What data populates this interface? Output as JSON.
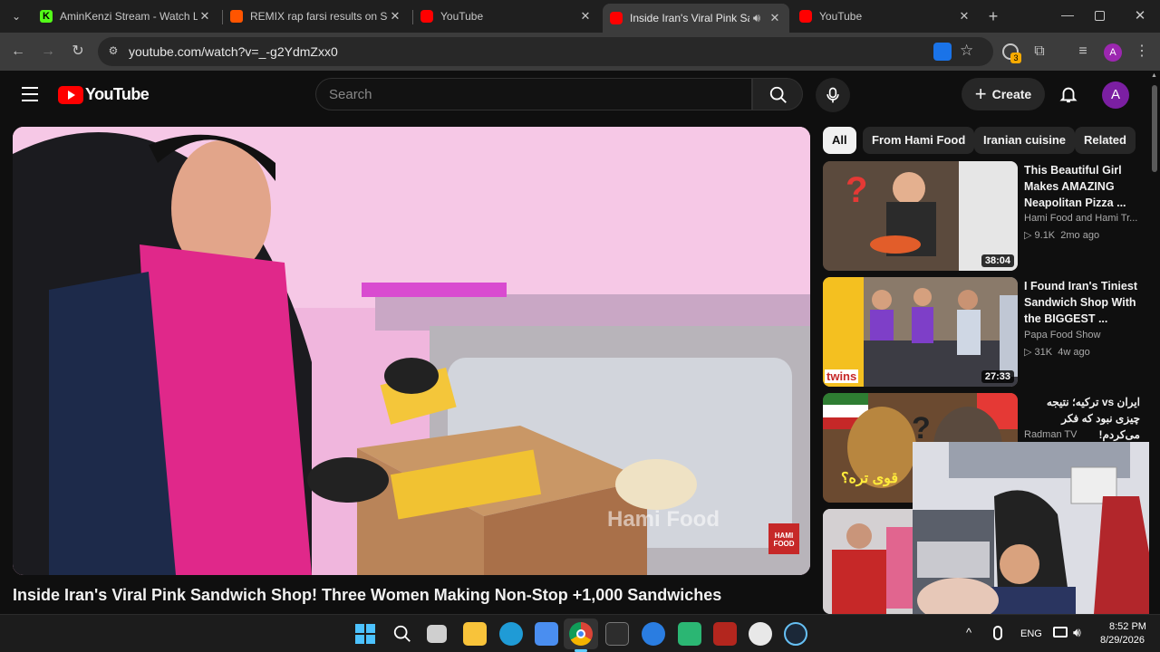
{
  "browser": {
    "tabs": [
      {
        "title": "AminKenzi Stream - Watch Liv",
        "favicon_color": "#53fc18",
        "favicon_letter": "K"
      },
      {
        "title": "REMIX rap farsi results on Sou",
        "favicon_color": "#ff5500",
        "favicon_letter": ""
      },
      {
        "title": "YouTube",
        "favicon_color": "#ff0000",
        "favicon_letter": ""
      },
      {
        "title": "Inside Iran's Viral Pink Sand",
        "favicon_color": "#ff0000",
        "favicon_letter": "",
        "active": true
      },
      {
        "title": "YouTube",
        "favicon_color": "#ff0000",
        "favicon_letter": ""
      }
    ],
    "new_tab": "+",
    "url": "youtube.com/watch?v=_-g2YdmZxx0",
    "extension_badge": "3",
    "profile_letter": "A"
  },
  "youtube": {
    "logo_text": "YouTube",
    "search_placeholder": "Search",
    "create_label": "Create",
    "avatar_letter": "A",
    "video": {
      "title": "Inside Iran's Viral Pink Sandwich Shop! Three Women Making Non-Stop +1,000 Sandwiches",
      "watermark": "Hami Food",
      "logo_lines": [
        "HAMI",
        "FOOD"
      ]
    },
    "chips": [
      "All",
      "From Hami Food",
      "Iranian cuisine",
      "Related"
    ],
    "recommendations": [
      {
        "title": "This Beautiful Girl Makes AMAZING Neapolitan Pizza ...",
        "channel": "Hami Food and Hami Tr...",
        "views": "9.1K",
        "age": "2mo ago",
        "duration": "38:04"
      },
      {
        "title": "I Found Iran's Tiniest Sandwich Shop With the BIGGEST ...",
        "channel": "Papa Food Show",
        "views": "31K",
        "age": "4w ago",
        "duration": "27:33"
      },
      {
        "title": "ایران vs ترکیه؛ نتیجه چیزی نبود که فکر می‌کردم!",
        "channel": "Radman TV",
        "views": "",
        "age": "",
        "duration": ""
      }
    ],
    "thumb_texts": [
      "twins",
      "قوی تره؟"
    ]
  },
  "taskbar": {
    "language": "ENG",
    "time": "8:52 PM",
    "date": "8/29/2026"
  }
}
